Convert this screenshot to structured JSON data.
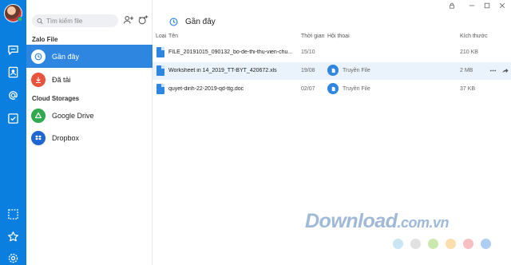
{
  "sidebar": {
    "search_placeholder": "Tìm kiếm file",
    "section_zalo": "Zalo File",
    "section_cloud": "Cloud Storages",
    "items": [
      {
        "label": "Gần đây",
        "icon": "clock-icon"
      },
      {
        "label": "Đã tải",
        "icon": "download-icon"
      },
      {
        "label": "Google Drive",
        "icon": "google-drive-icon"
      },
      {
        "label": "Dropbox",
        "icon": "dropbox-icon"
      }
    ]
  },
  "main": {
    "title": "Gần đây",
    "columns": {
      "type": "Loại",
      "name": "Tên",
      "time": "Thời gian",
      "conversation": "Hội thoại",
      "size": "Kích thước"
    },
    "rows": [
      {
        "name": "FILE_20191015_090132_bo-de-thi-thu-vien-chu...",
        "time": "15/10",
        "conversation": "",
        "size": "210 KB"
      },
      {
        "name": "Worksheet in 14_2019_TT-BYT_420672.xls",
        "time": "19/08",
        "conversation": "Truyền File",
        "size": "2 MB"
      },
      {
        "name": "quyet-dinh-22-2019-qd-ttg.doc",
        "time": "02/07",
        "conversation": "Truyền File",
        "size": "37 KB"
      }
    ]
  },
  "watermark": {
    "text": "Download",
    "domain": ".com.vn"
  },
  "colors": {
    "rail": "#0b7fe0",
    "active_item": "#2f86e0",
    "highlight_row": "#eaf2fb",
    "dot_colors": [
      "#9fd0ea",
      "#c9c9c9",
      "#9ed66b",
      "#f5c46a",
      "#f08c8c",
      "#6aa6e8"
    ]
  }
}
